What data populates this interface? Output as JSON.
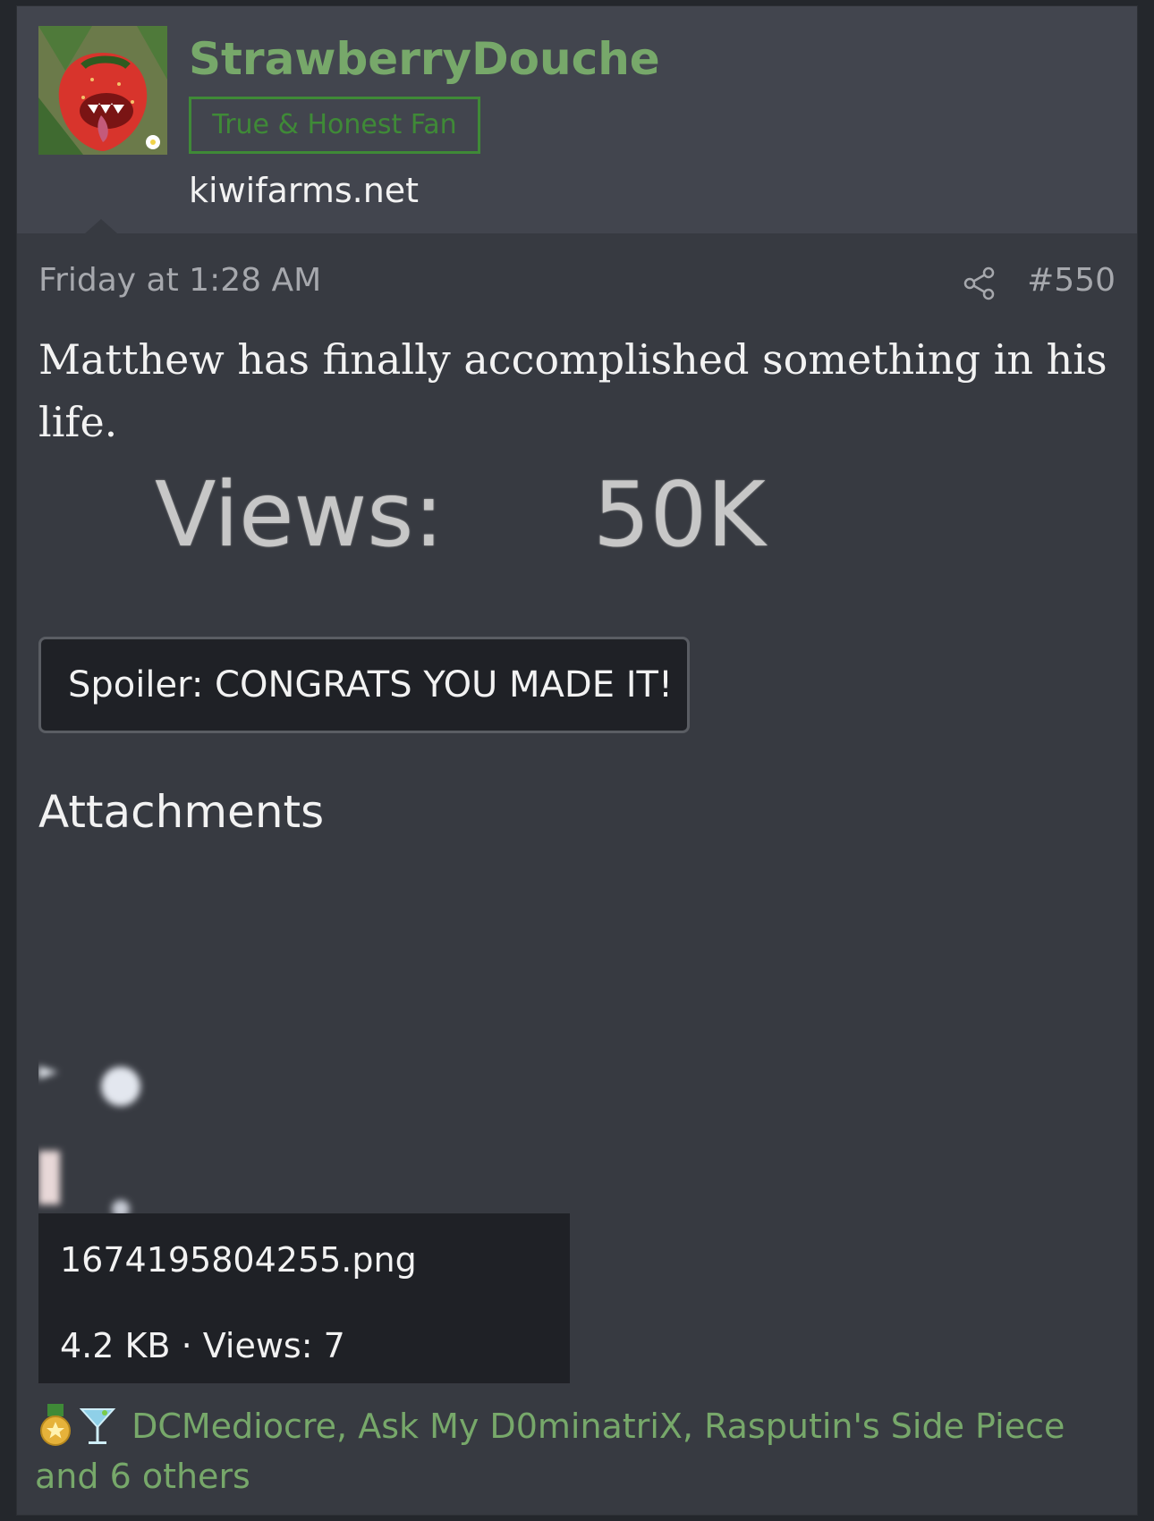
{
  "post": {
    "username": "StrawberryDouche",
    "user_title": "True & Honest Fan",
    "user_banner": "kiwifarms.net",
    "date": "Friday at 1:28 AM",
    "post_number": "#550",
    "message": "Matthew has finally accomplished something in his life.",
    "image_text": {
      "label": "Views:",
      "value": "50K"
    },
    "spoiler_label": "Spoiler: CONGRATS YOU MADE IT!",
    "attachments_heading": "Attachments",
    "attachment": {
      "filename": "1674195804255.png",
      "meta": "4.2 KB · Views: 7"
    },
    "reactions_text": "DCMediocre, Ask My D0minatriX, Rasputin's Side Piece and 6 others"
  },
  "colors": {
    "username": "#77a86a",
    "user_title_border": "#3f8a37",
    "post_bg": "#373a41",
    "header_bg": "#42454e"
  },
  "icons": [
    "share-icon",
    "medal-icon",
    "cocktail-icon"
  ]
}
